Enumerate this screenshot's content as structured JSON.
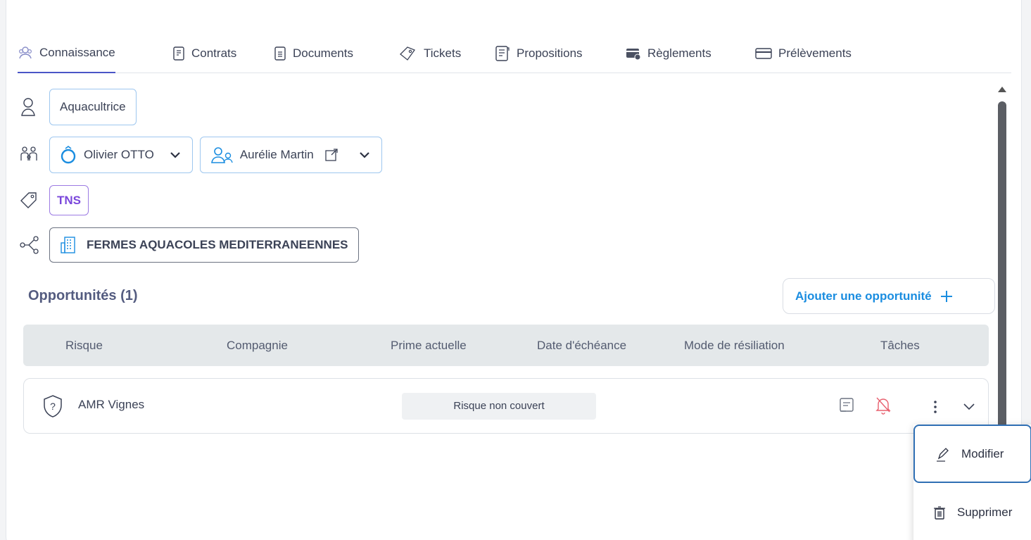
{
  "tabs": [
    {
      "label": "Connaissance",
      "icon": "user-group-icon",
      "active": true
    },
    {
      "label": "Contrats",
      "icon": "contract-icon"
    },
    {
      "label": "Documents",
      "icon": "document-icon"
    },
    {
      "label": "Tickets",
      "icon": "ticket-icon"
    },
    {
      "label": "Propositions",
      "icon": "proposal-icon"
    },
    {
      "label": "Règlements",
      "icon": "payment-icon"
    },
    {
      "label": "Prélèvements",
      "icon": "card-icon"
    }
  ],
  "profession": "Aquacultrice",
  "family": {
    "spouse": "Olivier OTTO",
    "relation": "Aurélie Martin"
  },
  "tag": "TNS",
  "company": "FERMES AQUACOLES MEDITERRANEENNES",
  "opportunities": {
    "title": "Opportunités (1)",
    "add_label": "Ajouter une opportunité",
    "columns": [
      "Risque",
      "Compagnie",
      "Prime actuelle",
      "Date d'échéance",
      "Mode de résiliation",
      "Tâches"
    ],
    "rows": [
      {
        "risk": "AMR Vignes",
        "status": "Risque non couvert"
      }
    ]
  },
  "menu": {
    "edit_label": "Modifier",
    "delete_label": "Supprimer"
  },
  "colors": {
    "accent": "#1a8de0",
    "active_tab": "#4a55c7",
    "tag_purple": "#7a47db",
    "bell_red": "#e8606f"
  }
}
